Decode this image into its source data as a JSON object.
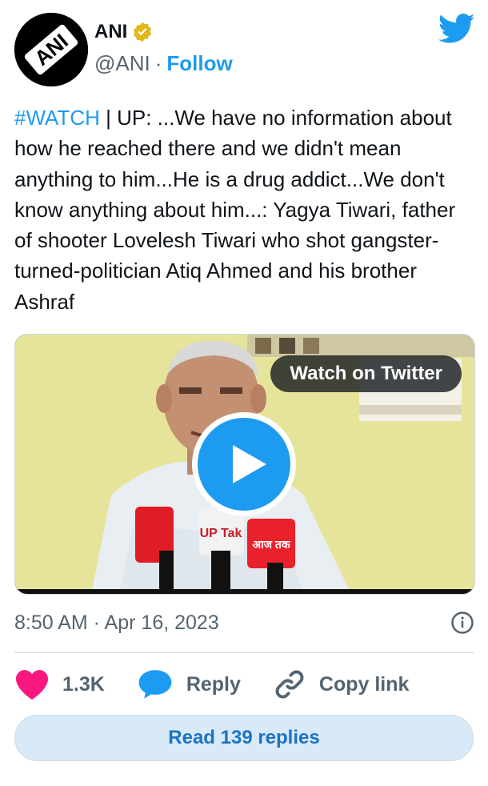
{
  "author": {
    "name": "ANI",
    "handle": "@ANI",
    "separator": "·",
    "follow_label": "Follow",
    "avatar_logo_text": "ANI",
    "verified_icon": "verified-badge-icon"
  },
  "tweet": {
    "hashtag": "#WATCH",
    "text": " | UP: ...We have no information about how he reached there and we didn't mean anything to him...He is a drug addict...We don't know anything about him...: Yagya Tiwari, father of shooter Lovelesh Tiwari who shot gangster-turned-politician Atiq Ahmed and his brother Ashraf"
  },
  "media": {
    "watch_label": "Watch on Twitter",
    "mic_labels": [
      "UP Tak",
      "आज तक"
    ]
  },
  "meta": {
    "timestamp": "8:50 AM · Apr 16, 2023"
  },
  "actions": {
    "like_count": "1.3K",
    "reply_label": "Reply",
    "copy_label": "Copy link"
  },
  "read_replies_label": "Read 139 replies",
  "colors": {
    "brand_blue": "#1d9bf0",
    "like_pink": "#f91880",
    "verified_gold": "#e2b719",
    "text_primary": "#0f1419",
    "text_secondary": "#536471"
  }
}
